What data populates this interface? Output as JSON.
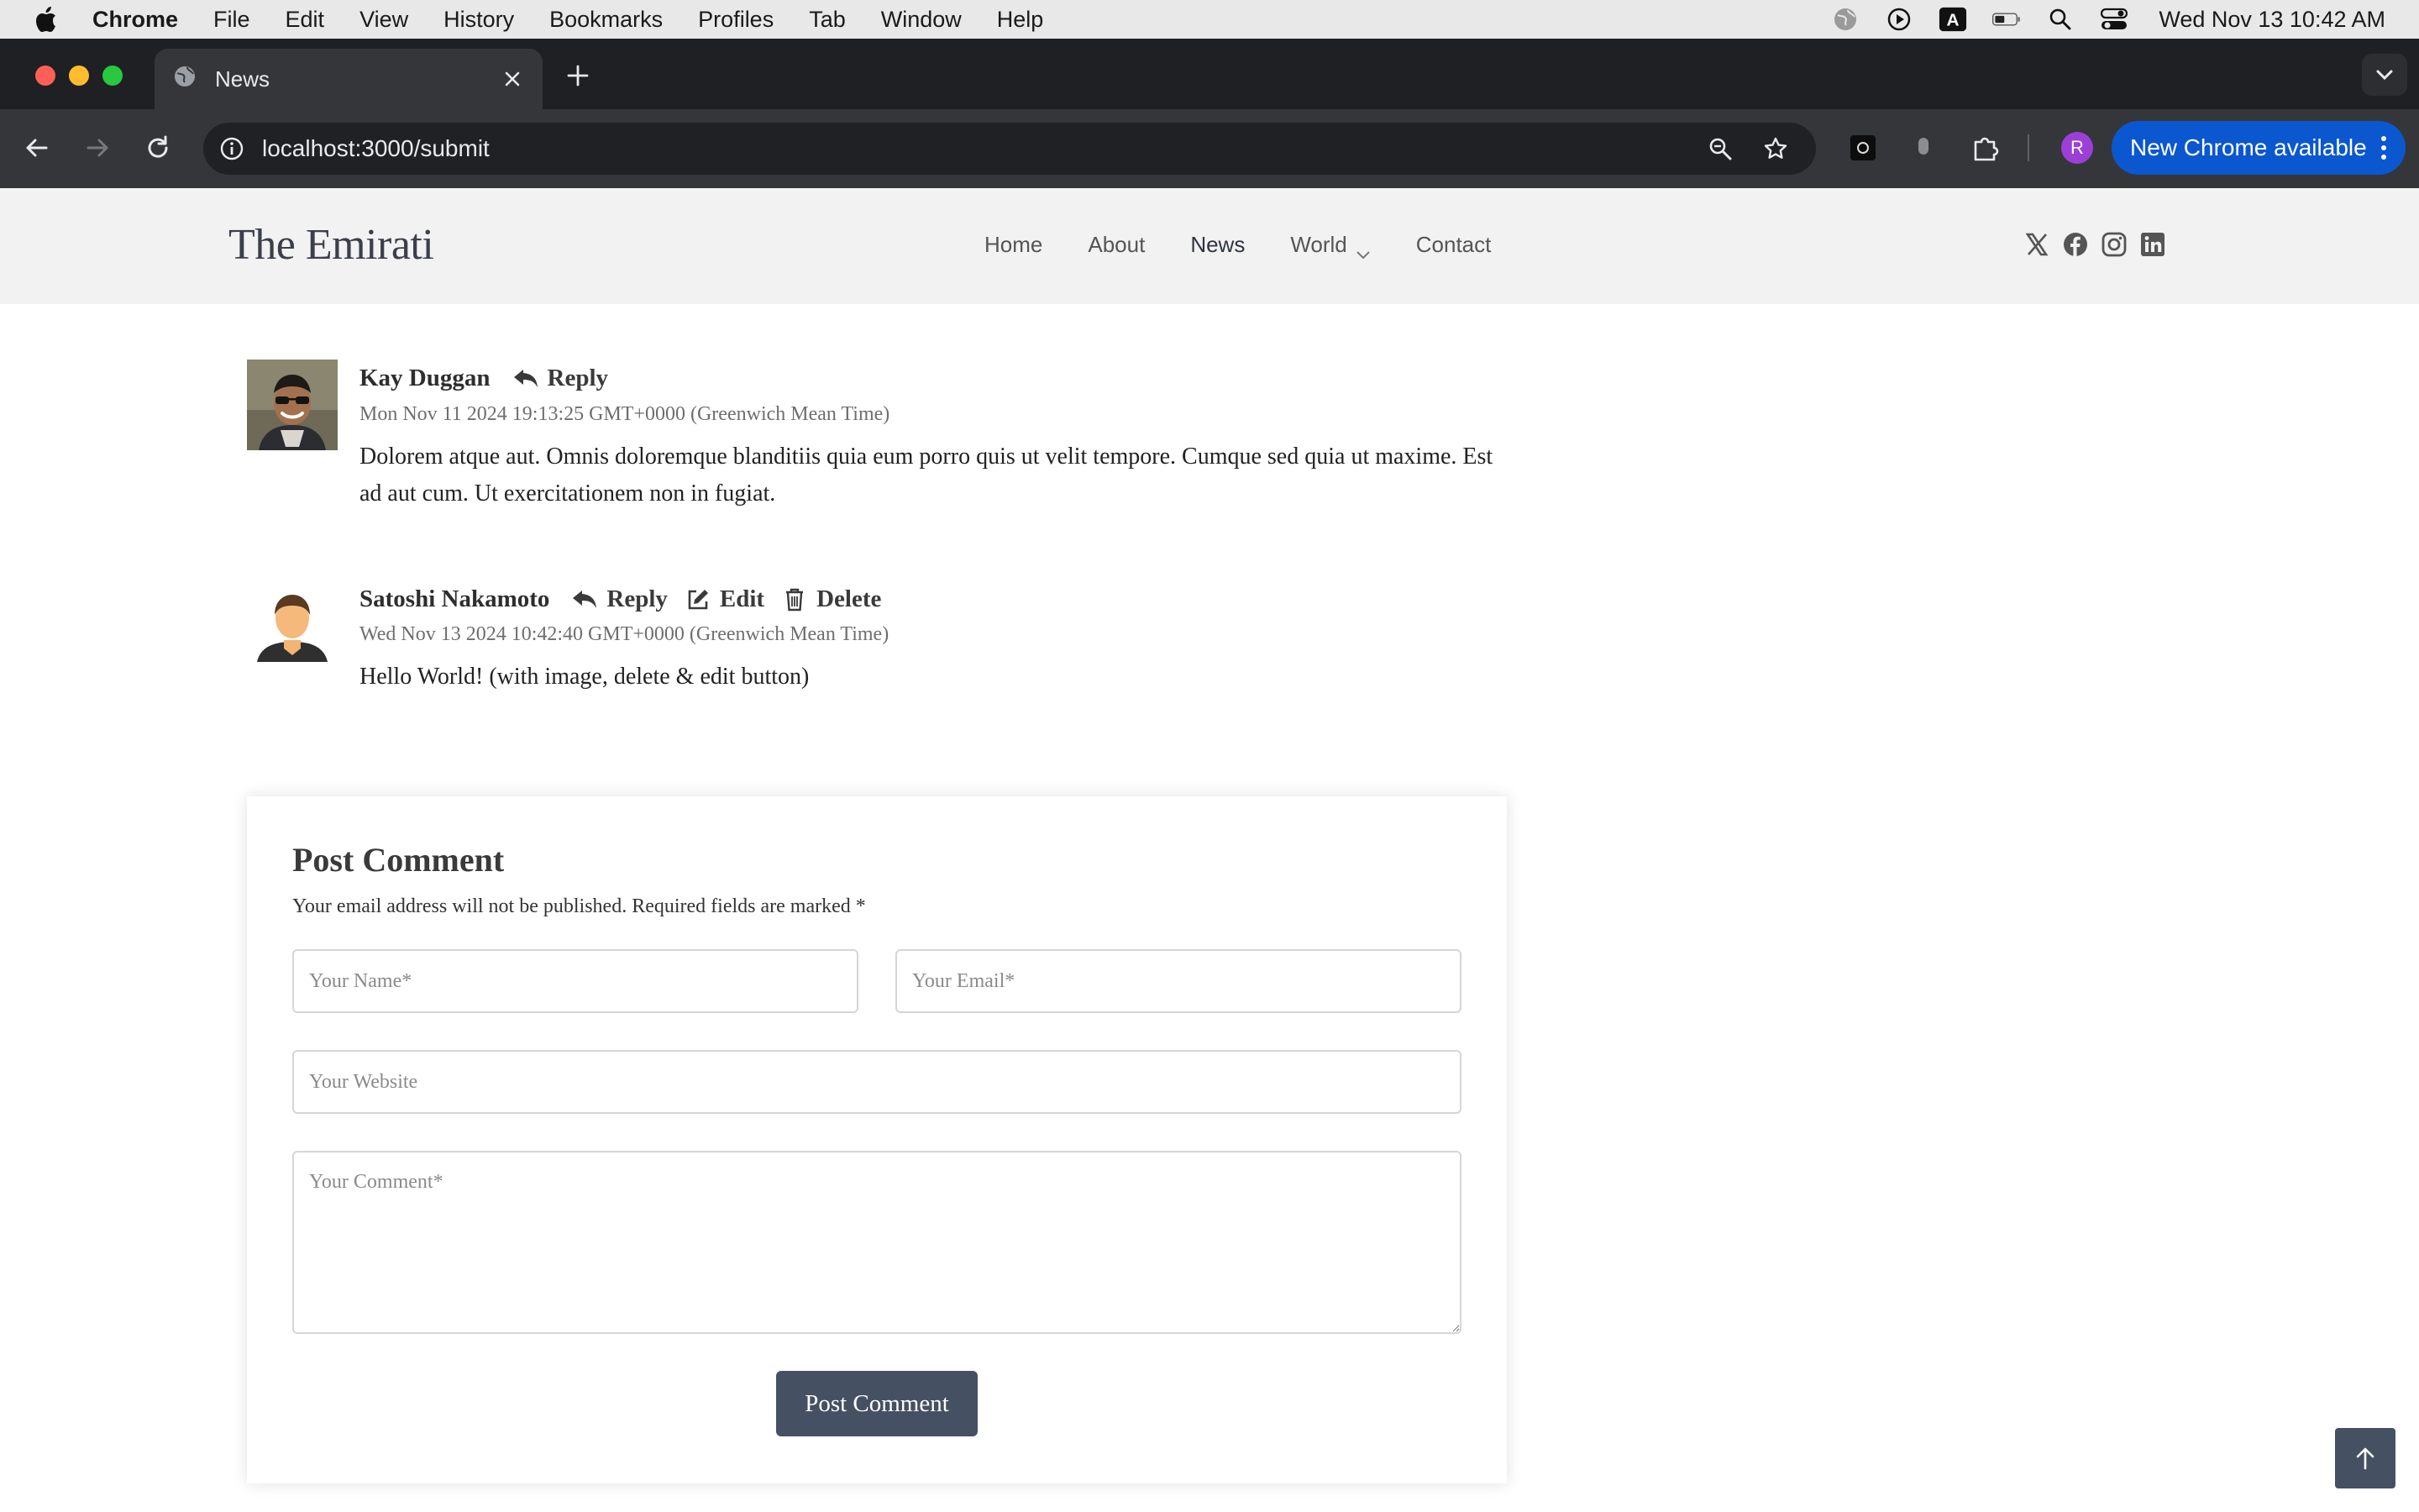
{
  "menubar": {
    "app_name": "Chrome",
    "items": [
      "File",
      "Edit",
      "View",
      "History",
      "Bookmarks",
      "Profiles",
      "Tab",
      "Window",
      "Help"
    ],
    "clock": "Wed Nov 13  10:42 AM"
  },
  "browser": {
    "tab_title": "News",
    "url": "localhost:3000/submit",
    "profile_initial": "R",
    "update_label": "New Chrome available"
  },
  "site": {
    "logo": "The Emirati",
    "nav": [
      {
        "label": "Home"
      },
      {
        "label": "About"
      },
      {
        "label": "News"
      },
      {
        "label": "World"
      },
      {
        "label": "Contact"
      }
    ],
    "social_icons": [
      "x-icon",
      "facebook-icon",
      "instagram-icon",
      "linkedin-icon"
    ]
  },
  "comments": [
    {
      "author": "Kay Duggan",
      "reply_label": "Reply",
      "date": "Mon Nov 11 2024 19:13:25 GMT+0000 (Greenwich Mean Time)",
      "body": "Dolorem atque aut. Omnis doloremque blanditiis quia eum porro quis ut velit tempore. Cumque sed quia ut maxime. Est ad aut cum. Ut exercitationem non in fugiat."
    },
    {
      "author": "Satoshi Nakamoto",
      "reply_label": "Reply",
      "edit_label": "Edit",
      "delete_label": "Delete",
      "date": "Wed Nov 13 2024 10:42:40 GMT+0000 (Greenwich Mean Time)",
      "body": "Hello World! (with image, delete & edit button)"
    }
  ],
  "form": {
    "title": "Post Comment",
    "note": "Your email address will not be published. Required fields are marked *",
    "name_placeholder": "Your Name*",
    "email_placeholder": "Your Email*",
    "website_placeholder": "Your Website",
    "comment_placeholder": "Your Comment*",
    "submit_label": "Post Comment"
  },
  "colors": {
    "accent": "#465063",
    "header_bg": "#f2f2f2",
    "chrome_update": "#0b57d0"
  }
}
